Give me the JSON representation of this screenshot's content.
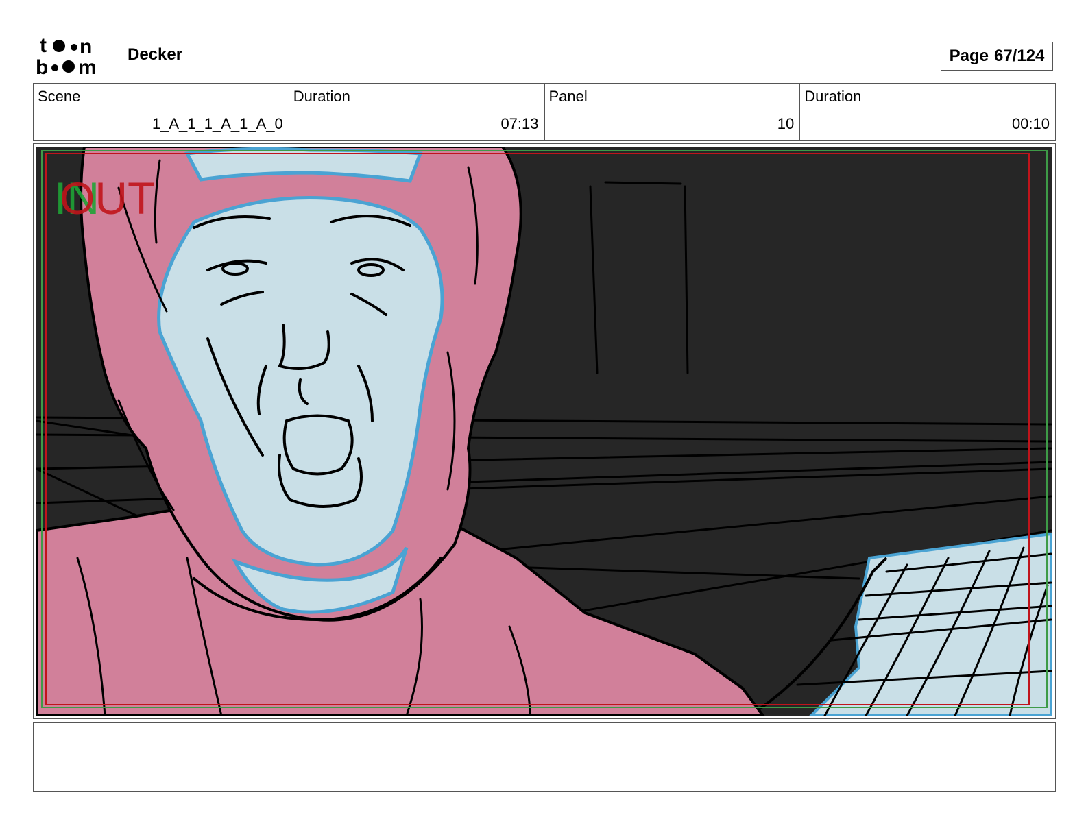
{
  "header": {
    "logo_text": "toon boom",
    "project_title": "Decker",
    "page_label": "Page",
    "page_number": "67/124"
  },
  "info": {
    "scene_label": "Scene",
    "scene_value": "1_A_1_1_A_1_A_0",
    "scene_duration_label": "Duration",
    "scene_duration_value": "07:13",
    "panel_label": "Panel",
    "panel_value": "10",
    "panel_duration_label": "Duration",
    "panel_duration_value": "00:10"
  },
  "panel": {
    "in_marker": "IN",
    "out_marker": "OUT"
  },
  "notes": {
    "text": ""
  },
  "colors": {
    "background_dark": "#262626",
    "character_pink": "#d1809a",
    "skin_light_blue": "#c9dfe7",
    "outline_blue": "#4aa3d3",
    "in_green": "#1fa336",
    "out_red": "#c0141b",
    "safe_frame_red": "#c0141b",
    "safe_frame_green": "#3e9b47"
  }
}
